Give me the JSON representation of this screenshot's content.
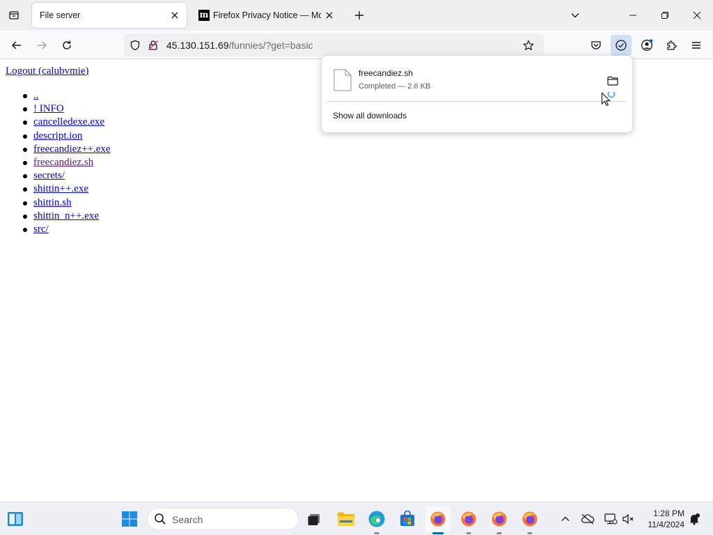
{
  "browser": {
    "tabs": [
      {
        "title": "File server",
        "active": true
      },
      {
        "title": "Firefox Privacy Notice — Mozill",
        "active": false,
        "favicon_text": "m"
      }
    ],
    "url": {
      "host": "45.130.151.69",
      "path": "/funnies/?get=basic"
    }
  },
  "page": {
    "logout_link": "Logout (calubvmie)",
    "files": [
      {
        "name": "..",
        "visited": false
      },
      {
        "name": "! INFO",
        "visited": false
      },
      {
        "name": "cancelledexe.exe",
        "visited": false
      },
      {
        "name": "descript.ion",
        "visited": false
      },
      {
        "name": "freecandiez++.exe",
        "visited": false
      },
      {
        "name": "freecandiez.sh",
        "visited": true
      },
      {
        "name": "secrets/",
        "visited": false
      },
      {
        "name": "shittin++.exe",
        "visited": false
      },
      {
        "name": "shittin.sh",
        "visited": false
      },
      {
        "name": "shittin_n++.exe",
        "visited": false
      },
      {
        "name": "src/",
        "visited": false
      }
    ]
  },
  "downloads_panel": {
    "file_name": "freecandiez.sh",
    "status": "Completed — 2.6 KB",
    "show_all_label": "Show all downloads"
  },
  "taskbar": {
    "search_label": "Search",
    "clock_time": "1:28 PM",
    "clock_date": "11/4/2024"
  },
  "colors": {
    "link": "#0000ee",
    "visited_link": "#551a8b",
    "accent": "#0061e0",
    "taskbar_active": "#0067c0"
  }
}
